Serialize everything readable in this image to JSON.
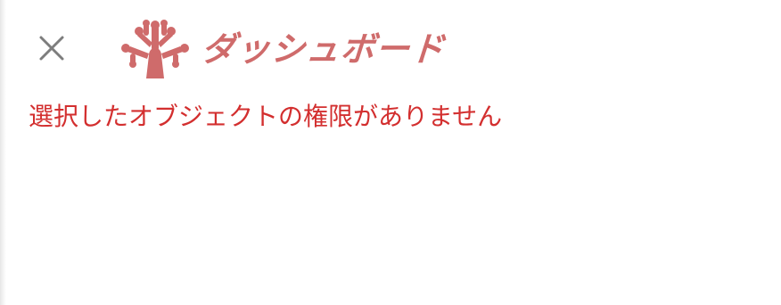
{
  "header": {
    "close_icon": "close-icon",
    "logo_icon": "coral-icon",
    "logo_text": "ダッシュボード",
    "brand_color": "#cf6b6b"
  },
  "message": {
    "error_text": "選択したオブジェクトの権限がありません",
    "error_color": "#d32f2f"
  }
}
